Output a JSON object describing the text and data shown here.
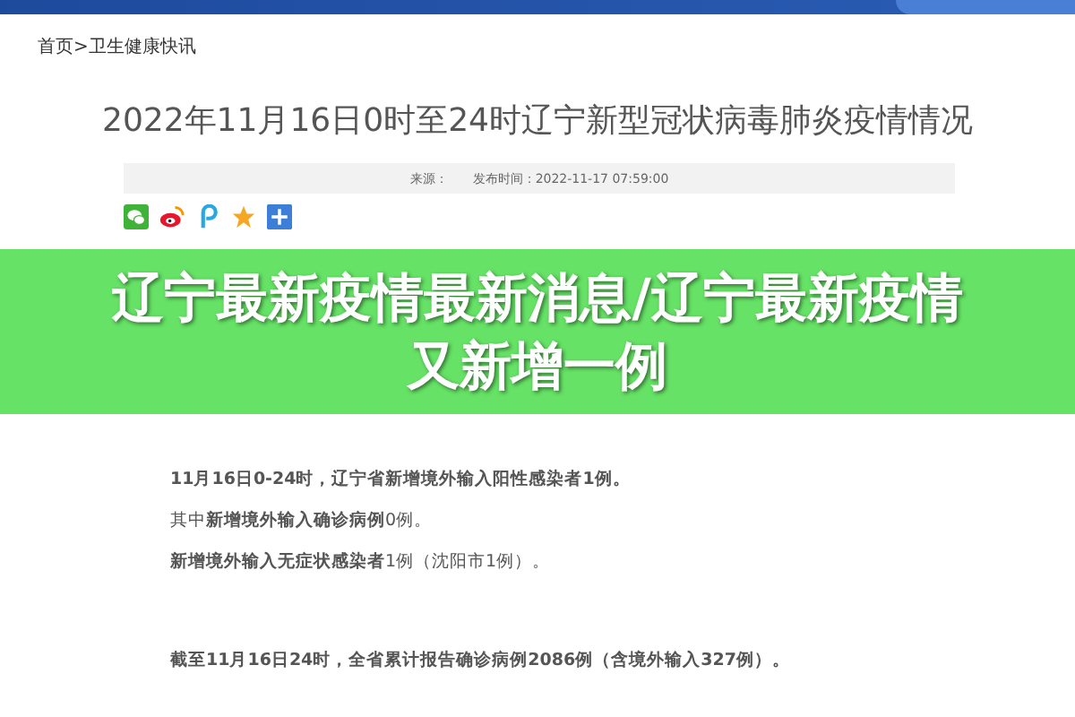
{
  "breadcrumb": "首页>卫生健康快讯",
  "article": {
    "title": "2022年11月16日0时至24时辽宁新型冠状病毒肺炎疫情情况",
    "source_label": "来源：",
    "published": "发布时间：2022-11-17 07:59:00"
  },
  "share_icons": [
    {
      "kind": "wechat"
    },
    {
      "kind": "weibo"
    },
    {
      "kind": "p"
    },
    {
      "kind": "star"
    },
    {
      "kind": "plus"
    }
  ],
  "banner": {
    "title": "辽宁最新疫情最新消息/辽宁最新疫情又新增一例"
  },
  "paragraphs": [
    {
      "text": "11月16日0-24时，辽宁省新增境外输入阳性感染者1例。",
      "bold": true,
      "gap_before": false
    },
    {
      "text": "其中**新增境外输入确诊病例**0例。",
      "bold": false,
      "gap_before": false
    },
    {
      "text": "**新增境外输入无症状感染者**1例（沈阳市1例）。",
      "bold": false,
      "gap_before": false
    },
    {
      "text": "截至11月16日24时，全省累计报告确诊病例2086例（含境外输入327例）。",
      "bold": true,
      "gap_before": true
    }
  ]
}
